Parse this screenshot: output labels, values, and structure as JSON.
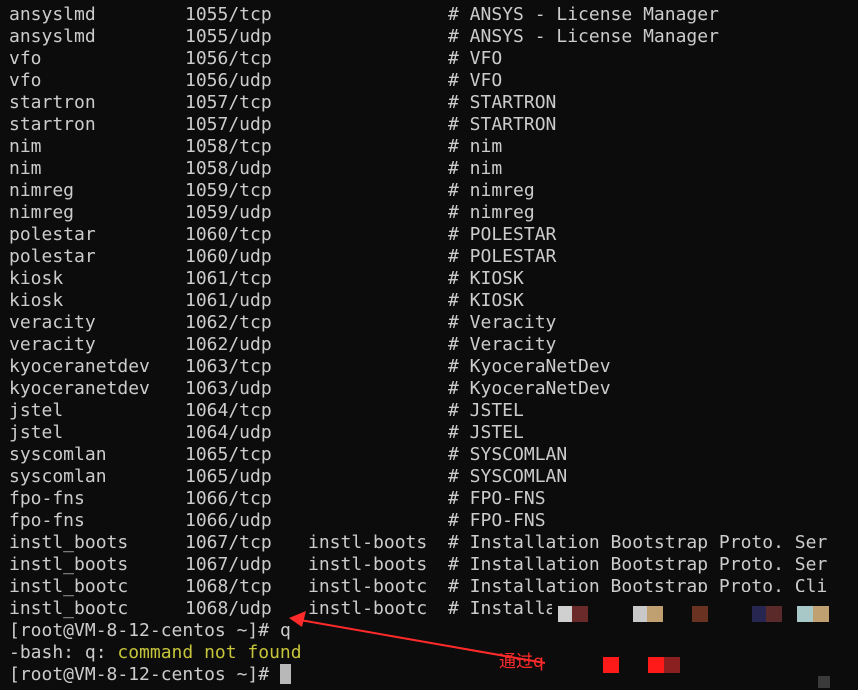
{
  "services": [
    {
      "name": "ansyslmd",
      "port": "1055/tcp",
      "alias": "",
      "comment": "# ANSYS - License Manager"
    },
    {
      "name": "ansyslmd",
      "port": "1055/udp",
      "alias": "",
      "comment": "# ANSYS - License Manager"
    },
    {
      "name": "vfo",
      "port": "1056/tcp",
      "alias": "",
      "comment": "# VFO"
    },
    {
      "name": "vfo",
      "port": "1056/udp",
      "alias": "",
      "comment": "# VFO"
    },
    {
      "name": "startron",
      "port": "1057/tcp",
      "alias": "",
      "comment": "# STARTRON"
    },
    {
      "name": "startron",
      "port": "1057/udp",
      "alias": "",
      "comment": "# STARTRON"
    },
    {
      "name": "nim",
      "port": "1058/tcp",
      "alias": "",
      "comment": "# nim"
    },
    {
      "name": "nim",
      "port": "1058/udp",
      "alias": "",
      "comment": "# nim"
    },
    {
      "name": "nimreg",
      "port": "1059/tcp",
      "alias": "",
      "comment": "# nimreg"
    },
    {
      "name": "nimreg",
      "port": "1059/udp",
      "alias": "",
      "comment": "# nimreg"
    },
    {
      "name": "polestar",
      "port": "1060/tcp",
      "alias": "",
      "comment": "# POLESTAR"
    },
    {
      "name": "polestar",
      "port": "1060/udp",
      "alias": "",
      "comment": "# POLESTAR"
    },
    {
      "name": "kiosk",
      "port": "1061/tcp",
      "alias": "",
      "comment": "# KIOSK"
    },
    {
      "name": "kiosk",
      "port": "1061/udp",
      "alias": "",
      "comment": "# KIOSK"
    },
    {
      "name": "veracity",
      "port": "1062/tcp",
      "alias": "",
      "comment": "# Veracity"
    },
    {
      "name": "veracity",
      "port": "1062/udp",
      "alias": "",
      "comment": "# Veracity"
    },
    {
      "name": "kyoceranetdev",
      "port": "1063/tcp",
      "alias": "",
      "comment": "# KyoceraNetDev"
    },
    {
      "name": "kyoceranetdev",
      "port": "1063/udp",
      "alias": "",
      "comment": "# KyoceraNetDev"
    },
    {
      "name": "jstel",
      "port": "1064/tcp",
      "alias": "",
      "comment": "# JSTEL"
    },
    {
      "name": "jstel",
      "port": "1064/udp",
      "alias": "",
      "comment": "# JSTEL"
    },
    {
      "name": "syscomlan",
      "port": "1065/tcp",
      "alias": "",
      "comment": "# SYSCOMLAN"
    },
    {
      "name": "syscomlan",
      "port": "1065/udp",
      "alias": "",
      "comment": "# SYSCOMLAN"
    },
    {
      "name": "fpo-fns",
      "port": "1066/tcp",
      "alias": "",
      "comment": "# FPO-FNS"
    },
    {
      "name": "fpo-fns",
      "port": "1066/udp",
      "alias": "",
      "comment": "# FPO-FNS"
    },
    {
      "name": "instl_boots",
      "port": "1067/tcp",
      "alias": "instl-boots",
      "comment": "# Installation Bootstrap Proto. Ser"
    },
    {
      "name": "instl_boots",
      "port": "1067/udp",
      "alias": "instl-boots",
      "comment": "# Installation Bootstrap Proto. Ser"
    },
    {
      "name": "instl_bootc",
      "port": "1068/tcp",
      "alias": "instl-bootc",
      "comment": "# Installation Bootstrap Proto. Cli"
    },
    {
      "name": "instl_bootc",
      "port": "1068/udp",
      "alias": "instl-bootc",
      "comment": "# Installa"
    }
  ],
  "prompt1": {
    "prompt": "[root@VM-8-12-centos ~]# ",
    "command": "q"
  },
  "error": {
    "prefix": "-bash: q: ",
    "message": "command not found"
  },
  "prompt2": {
    "prompt": "[root@VM-8-12-centos ~]# "
  },
  "annotation": {
    "text": "通过q",
    "color": "#ff2a2a"
  },
  "colors": {
    "background": "#0c0c0c",
    "text": "#cccccc",
    "error": "#c7c43b",
    "annotation": "#ff2a2a"
  }
}
